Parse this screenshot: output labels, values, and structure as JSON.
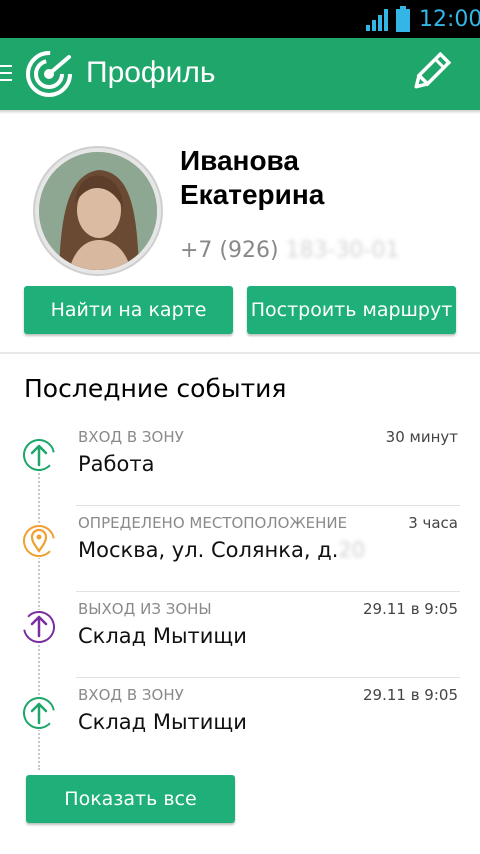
{
  "status_bar": {
    "time": "12:00"
  },
  "app_bar": {
    "title": "Профиль"
  },
  "profile": {
    "name_line1": "Иванова",
    "name_line2": "Екатерина",
    "phone_visible": "+7 (926) ",
    "phone_blurred": "183-30-01",
    "find_button": "Найти на карте",
    "route_button": "Построить маршрут"
  },
  "events": {
    "title": "Последние события",
    "items": [
      {
        "type": "ВХОД В ЗОНУ",
        "place": "Работа",
        "place_blurred": "",
        "time": "30 минут",
        "icon": "zone-enter-icon",
        "color": "#1fa66a"
      },
      {
        "type": "ОПРЕДЕЛЕНО МЕСТОПОЛОЖЕНИЕ",
        "place": "Москва, ул. Солянка, д.",
        "place_blurred": "20",
        "time": "3 часа",
        "icon": "location-pin-icon",
        "color": "#f0a030"
      },
      {
        "type": "ВЫХОД ИЗ ЗОНЫ",
        "place": "Склад Мытищи",
        "place_blurred": "",
        "time": "29.11 в 9:05",
        "icon": "zone-exit-icon",
        "color": "#7a2fa0"
      },
      {
        "type": "ВХОД В ЗОНУ",
        "place": "Склад Мытищи",
        "place_blurred": "",
        "time": "29.11 в 9:05",
        "icon": "zone-enter-icon",
        "color": "#1fa66a"
      }
    ],
    "show_all_button": "Показать все"
  },
  "colors": {
    "primary": "#1fa66a",
    "button": "#1fb07a",
    "status_time": "#33b5e5"
  }
}
